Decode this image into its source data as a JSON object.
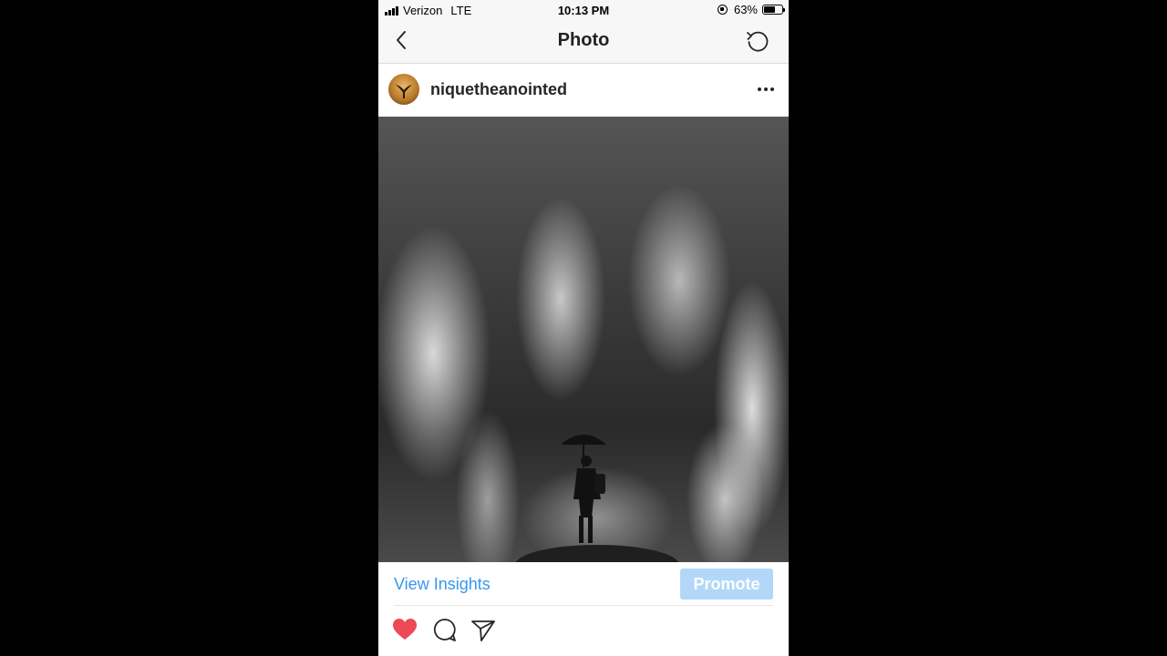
{
  "status_bar": {
    "carrier": "Verizon",
    "network": "LTE",
    "time": "10:13 PM",
    "battery_percent": "63%",
    "battery_level": 0.63
  },
  "nav": {
    "title": "Photo",
    "back_icon": "chevron-left-icon",
    "refresh_icon": "refresh-icon"
  },
  "post": {
    "username": "niquetheanointed",
    "more_icon": "more-horizontal-icon"
  },
  "insights": {
    "view_insights_label": "View Insights",
    "promote_label": "Promote"
  },
  "actions": {
    "like_icon": "heart-filled-icon",
    "comment_icon": "comment-icon",
    "share_icon": "send-icon",
    "like_color": "#ed4956"
  },
  "colors": {
    "link_blue": "#3897f0",
    "promote_disabled": "#b2d7f9"
  }
}
